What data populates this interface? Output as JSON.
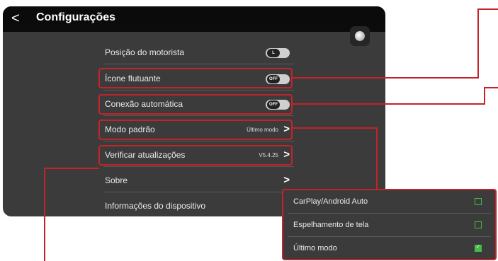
{
  "header": {
    "back_icon": "chevron-left-icon",
    "back_glyph": "<",
    "title": "Configurações"
  },
  "settings": [
    {
      "label": "Posição do motorista",
      "control": "toggle",
      "knob_text": "L"
    },
    {
      "label": "Ícone flutuante",
      "control": "toggle",
      "knob_text": "OFF"
    },
    {
      "label": "Conexão automática",
      "control": "toggle",
      "knob_text": "OFF"
    },
    {
      "label": "Modo padrão",
      "control": "chevron",
      "value": "Último modo"
    },
    {
      "label": "Verificar atualizações",
      "control": "chevron",
      "value": "V5.4.25"
    },
    {
      "label": "Sobre",
      "control": "chevron",
      "value": ""
    },
    {
      "label": "Informações do dispositivo",
      "control": "chevron",
      "value": ""
    }
  ],
  "chevron_glyph": ">",
  "mode_options": [
    {
      "label": "CarPlay/Android Auto",
      "checked": false
    },
    {
      "label": "Espelhamento de tela",
      "checked": false
    },
    {
      "label": "Último modo",
      "checked": true
    }
  ],
  "check_glyph": "✓",
  "colors": {
    "highlight": "#c4232a",
    "checkbox": "#48b94a",
    "panel": "#3b3b3b",
    "topbar": "#0b0b0b"
  }
}
